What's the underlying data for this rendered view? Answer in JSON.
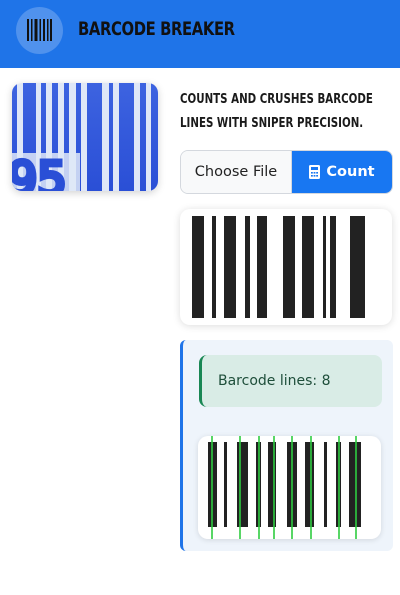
{
  "app": {
    "title": "BARCODE BREAKER",
    "logo_icon": "barcode-icon"
  },
  "thumbnail": {
    "digits_visible": "95"
  },
  "tagline": "Counts and crushes barcode lines with sniper precision.",
  "upload": {
    "choose_file_label": "Choose File",
    "count_button_label": "Count",
    "count_icon": "calculator-icon"
  },
  "result": {
    "alert_text": "Barcode lines: 8",
    "line_count": 8
  },
  "colors": {
    "header": "#1f74e8",
    "primary_button": "#1877f2",
    "success_bg": "#d9ece6",
    "detected_line": "#2ecc40"
  }
}
